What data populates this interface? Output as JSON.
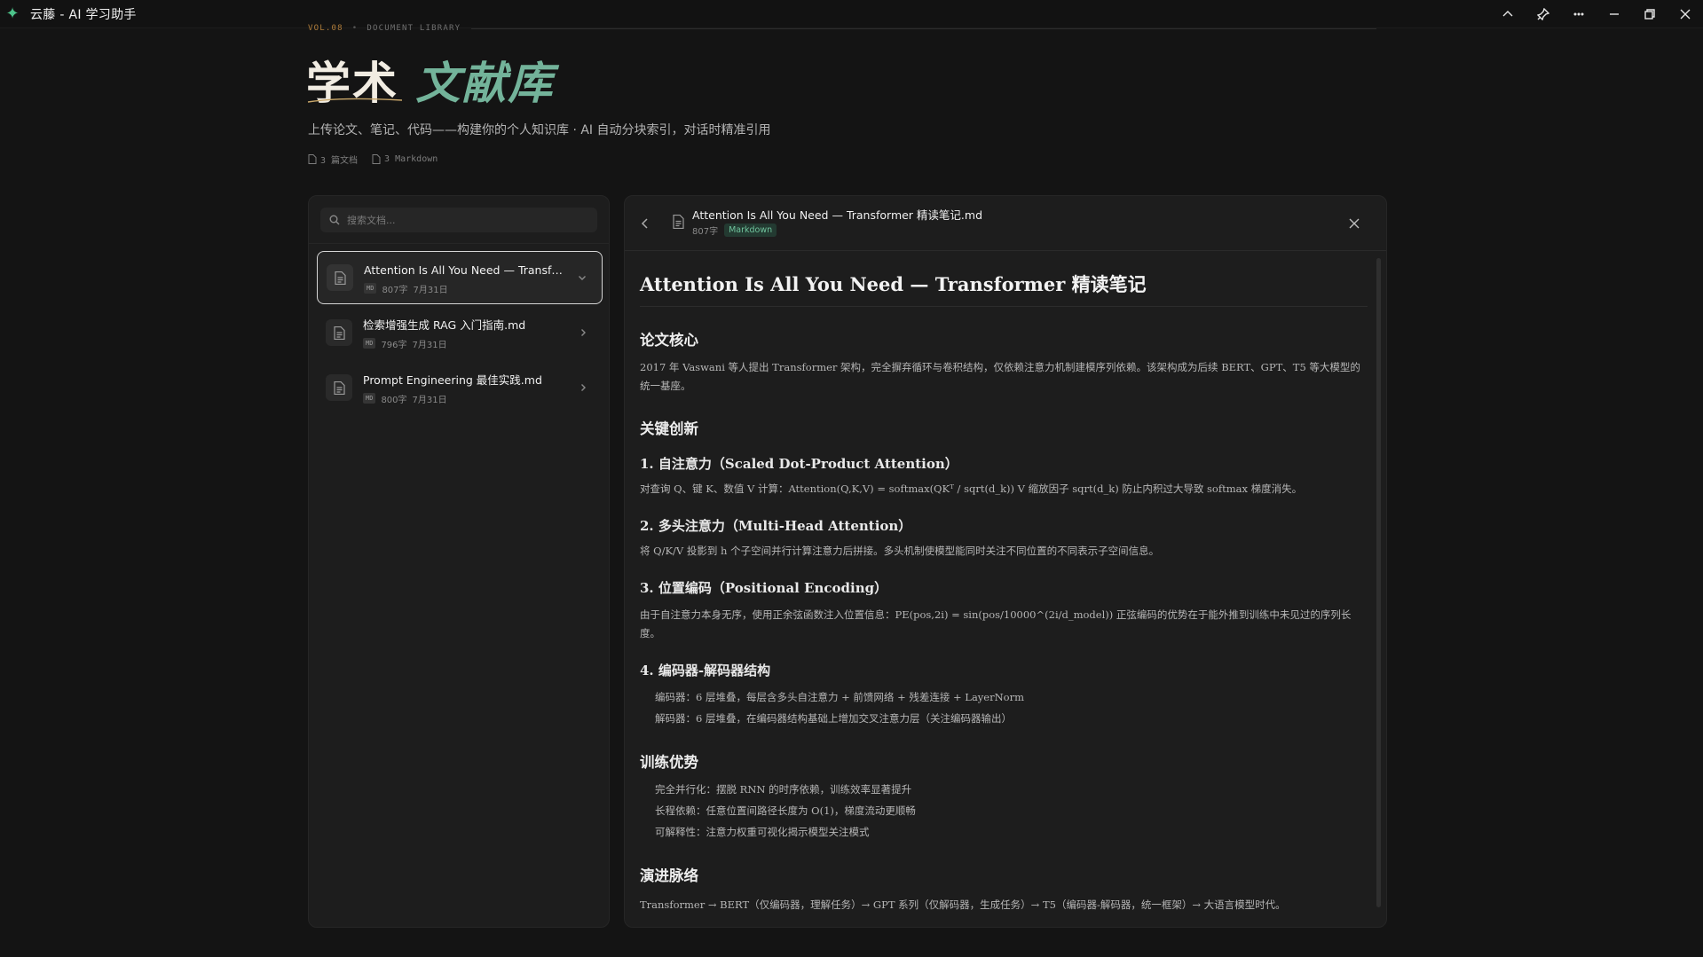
{
  "app": {
    "title": "云藤 - AI 学习助手"
  },
  "header": {
    "vol": "VOL.08",
    "section": "DOCUMENT LIBRARY",
    "title_plain": "学术",
    "title_accent": "文献库",
    "subtitle": "上传论文、笔记、代码——构建你的个人知识库 · AI 自动分块索引，对话时精准引用",
    "stats": [
      "3 篇文档",
      "3 Markdown"
    ]
  },
  "sidebar": {
    "search_placeholder": "搜索文档...",
    "docs": [
      {
        "name": "Attention Is All You Need — Transformer 精读笔记.md",
        "badge": "MD",
        "words": "807字",
        "date": "7月31日"
      },
      {
        "name": "检索增强生成 RAG 入门指南.md",
        "badge": "MD",
        "words": "796字",
        "date": "7月31日"
      },
      {
        "name": "Prompt Engineering 最佳实践.md",
        "badge": "MD",
        "words": "800字",
        "date": "7月31日"
      }
    ]
  },
  "viewer": {
    "filename": "Attention Is All You Need — Transformer 精读笔记.md",
    "words": "807字",
    "type": "Markdown",
    "h1": "Attention Is All You Need — Transformer 精读笔记",
    "s1_title": "论文核心",
    "s1_text": "2017 年 Vaswani 等人提出 Transformer 架构，完全摒弃循环与卷积结构，仅依赖注意力机制建模序列依赖。该架构成为后续 BERT、GPT、T5 等大模型的统一基座。",
    "s2_title": "关键创新",
    "i1_title": "1. 自注意力（Scaled Dot-Product Attention）",
    "i1_text": "对查询 Q、键 K、数值 V 计算：Attention(Q,K,V) = softmax(QKᵀ / sqrt(d_k)) V 缩放因子 sqrt(d_k) 防止内积过大导致 softmax 梯度消失。",
    "i2_title": "2. 多头注意力（Multi-Head Attention）",
    "i2_text": "将 Q/K/V 投影到 h 个子空间并行计算注意力后拼接。多头机制使模型能同时关注不同位置的不同表示子空间信息。",
    "i3_title": "3. 位置编码（Positional Encoding）",
    "i3_text": "由于自注意力本身无序，使用正余弦函数注入位置信息：PE(pos,2i) = sin(pos/10000^(2i/d_model)) 正弦编码的优势在于能外推到训练中未见过的序列长度。",
    "i4_title": "4. 编码器-解码器结构",
    "i4_items": [
      "编码器：6 层堆叠，每层含多头自注意力 + 前馈网络 + 残差连接 + LayerNorm",
      "解码器：6 层堆叠，在编码器结构基础上增加交叉注意力层（关注编码器输出）"
    ],
    "s3_title": "训练优势",
    "s3_items": [
      "完全并行化：摆脱 RNN 的时序依赖，训练效率显著提升",
      "长程依赖：任意位置间路径长度为 O(1)，梯度流动更顺畅",
      "可解释性：注意力权重可视化揭示模型关注模式"
    ],
    "s4_title": "演进脉络",
    "s4_text": "Transformer → BERT（仅编码器，理解任务）→ GPT 系列（仅解码器，生成任务）→ T5（编码器-解码器，统一框架）→ 大语言模型时代。"
  },
  "colors": {
    "accent": "#73b39a",
    "vol": "#b07d3a",
    "background": "#141414",
    "panel": "#1d1d1d"
  }
}
